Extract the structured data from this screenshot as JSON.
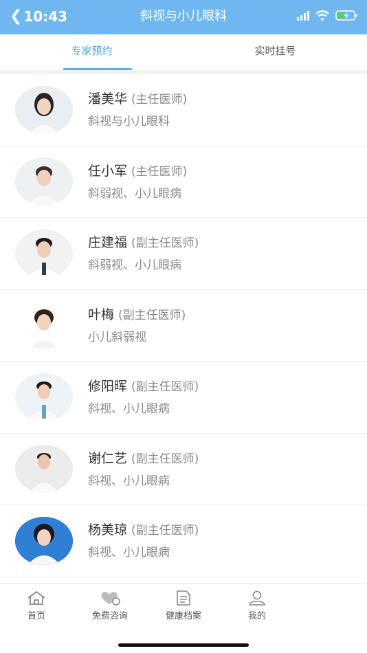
{
  "status_bar": {
    "time": "10:43"
  },
  "header": {
    "title": "斜视与小儿眼科"
  },
  "tabs": [
    {
      "label": "专家预约",
      "active": true
    },
    {
      "label": "实时挂号",
      "active": false
    }
  ],
  "doctors": [
    {
      "name": "潘美华",
      "title": "(主任医师)",
      "specialty": "斜视与小儿眼科"
    },
    {
      "name": "任小军",
      "title": "(主任医师)",
      "specialty": "斜弱视、小儿眼病"
    },
    {
      "name": "庄建福",
      "title": "(副主任医师)",
      "specialty": "斜弱视、小儿眼病"
    },
    {
      "name": "叶梅",
      "title": "(副主任医师)",
      "specialty": "小儿斜弱视"
    },
    {
      "name": "修阳晖",
      "title": "(副主任医师)",
      "specialty": "斜视、小儿眼病"
    },
    {
      "name": "谢仁艺",
      "title": "(副主任医师)",
      "specialty": "斜视、小儿眼病"
    },
    {
      "name": "杨美琼",
      "title": "(副主任医师)",
      "specialty": "斜视、小儿眼病"
    }
  ],
  "bottom_nav": [
    {
      "label": "首页",
      "icon": "home-icon"
    },
    {
      "label": "免费咨询",
      "icon": "heart-chat-icon"
    },
    {
      "label": "健康档案",
      "icon": "document-icon"
    },
    {
      "label": "我的",
      "icon": "user-icon"
    }
  ],
  "colors": {
    "header": "#6fb8ef",
    "accent": "#4ba6e8"
  }
}
